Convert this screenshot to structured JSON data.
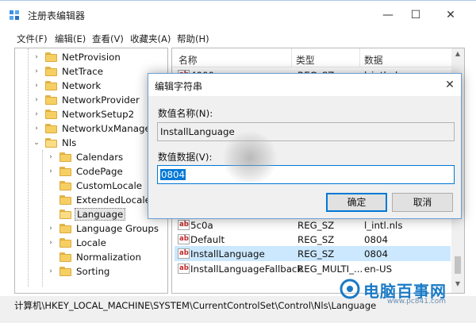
{
  "window": {
    "title": "注册表编辑器",
    "min_glyph": "—",
    "max_glyph": "☐",
    "close_glyph": "✕"
  },
  "menu": [
    "文件(F)",
    "编辑(E)",
    "查看(V)",
    "收藏夹(A)",
    "帮助(H)"
  ],
  "tree": {
    "items": [
      {
        "label": "NetProvision",
        "chevron": "›"
      },
      {
        "label": "NetTrace",
        "chevron": "›"
      },
      {
        "label": "Network",
        "chevron": "›"
      },
      {
        "label": "NetworkProvider",
        "chevron": "›"
      },
      {
        "label": "NetworkSetup2",
        "chevron": "›"
      },
      {
        "label": "NetworkUxManager",
        "chevron": "›"
      },
      {
        "label": "Nls",
        "chevron": "⌄"
      },
      {
        "label": "Calendars",
        "chevron": "›"
      },
      {
        "label": "CodePage",
        "chevron": "›"
      },
      {
        "label": "CustomLocale",
        "chevron": ""
      },
      {
        "label": "ExtendedLocale",
        "chevron": ""
      },
      {
        "label": "Language",
        "chevron": ""
      },
      {
        "label": "Language Groups",
        "chevron": "›"
      },
      {
        "label": "Locale",
        "chevron": "›"
      },
      {
        "label": "Normalization",
        "chevron": ""
      },
      {
        "label": "Sorting",
        "chevron": "›"
      }
    ]
  },
  "list": {
    "headers": {
      "name": "名称",
      "type": "类型",
      "data": "数据"
    },
    "rows": [
      {
        "name": "4000",
        "type": "REG_SZ",
        "data": "l_intl.nls"
      },
      {
        "name": "5c0a",
        "type": "REG_SZ",
        "data": "l_intl.nls"
      },
      {
        "name": "Default",
        "type": "REG_SZ",
        "data": "0804"
      },
      {
        "name": "InstallLanguage",
        "type": "REG_SZ",
        "data": "0804"
      },
      {
        "name": "InstallLanguageFallback",
        "type": "REG_MULTI_...",
        "data": "en-US"
      }
    ],
    "value_icon": "ab"
  },
  "status": {
    "path": "计算机\\HKEY_LOCAL_MACHINE\\SYSTEM\\CurrentControlSet\\Control\\Nls\\Language"
  },
  "dialog": {
    "title": "编辑字符串",
    "close_glyph": "✕",
    "name_label": "数值名称(N):",
    "name_value": "InstallLanguage",
    "data_label": "数值数据(V):",
    "data_value": "0804",
    "ok_label": "确定",
    "cancel_label": "取消"
  },
  "watermark": {
    "text": "电脑百事网",
    "sub": "www.pc841.com"
  },
  "colors": {
    "accent": "#0078d7",
    "selection": "#cce8ff",
    "folder": "#f6cf63"
  }
}
